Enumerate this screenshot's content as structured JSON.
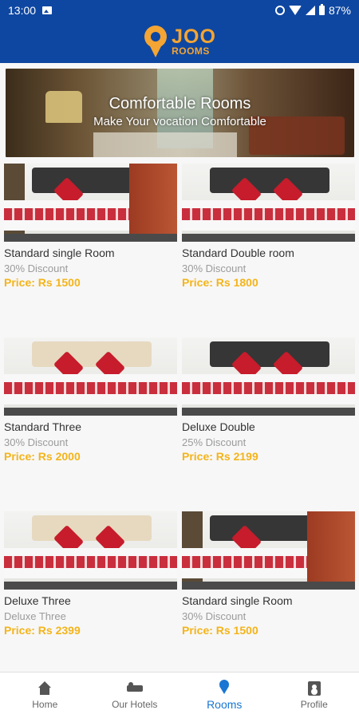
{
  "status_bar": {
    "time": "13:00",
    "battery": "87%"
  },
  "brand": {
    "name_main": "JOO",
    "name_sub": "ROOMS",
    "accent": "#f4a533",
    "header_bg": "#0e47a1"
  },
  "banner": {
    "title": "Comfortable Rooms",
    "subtitle": "Make Your vocation Comfortable"
  },
  "rooms": [
    {
      "title": "Standard single Room",
      "discount": "30% Discount",
      "price": "Price: Rs 1500",
      "image_style": "single"
    },
    {
      "title": "Standard Double room",
      "discount": "30% Discount",
      "price": "Price: Rs 1800",
      "image_style": "double"
    },
    {
      "title": "Standard Three",
      "discount": "30% Discount",
      "price": "Price: Rs 2000",
      "image_style": "three"
    },
    {
      "title": "Deluxe Double",
      "discount": "25% Discount",
      "price": "Price: Rs 2199",
      "image_style": "double"
    },
    {
      "title": "Deluxe Three",
      "discount": "Deluxe Three",
      "price": "Price: Rs 2399",
      "image_style": "three"
    },
    {
      "title": "Standard single Room",
      "discount": "30% Discount",
      "price": "Price: Rs 1500",
      "image_style": "single"
    }
  ],
  "bottom_nav": {
    "items": [
      {
        "label": "Home",
        "icon": "home-icon",
        "active": false
      },
      {
        "label": "Our Hotels",
        "icon": "hotel-icon",
        "active": false
      },
      {
        "label": "Rooms",
        "icon": "location-icon",
        "active": true
      },
      {
        "label": "Profile",
        "icon": "profile-icon",
        "active": false
      }
    ]
  }
}
